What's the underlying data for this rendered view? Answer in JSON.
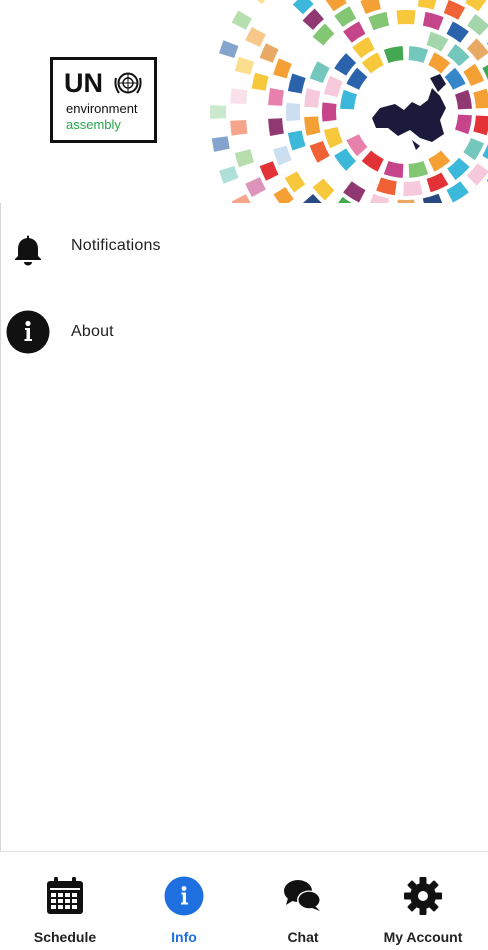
{
  "header": {
    "logo": {
      "line1": "UN",
      "line2": "environment",
      "line3": "assembly"
    }
  },
  "menu": {
    "items": [
      {
        "label": "Notifications",
        "icon": "bell-icon"
      },
      {
        "label": "About",
        "icon": "info-icon"
      }
    ]
  },
  "bottom_nav": {
    "active_tab": "Info",
    "accent_color": "#1e6fe0",
    "tabs": [
      {
        "label": "Schedule",
        "icon": "calendar-icon"
      },
      {
        "label": "Info",
        "icon": "info-icon"
      },
      {
        "label": "Chat",
        "icon": "chat-bubbles-icon"
      },
      {
        "label": "My Account",
        "icon": "gear-icon"
      }
    ]
  }
}
